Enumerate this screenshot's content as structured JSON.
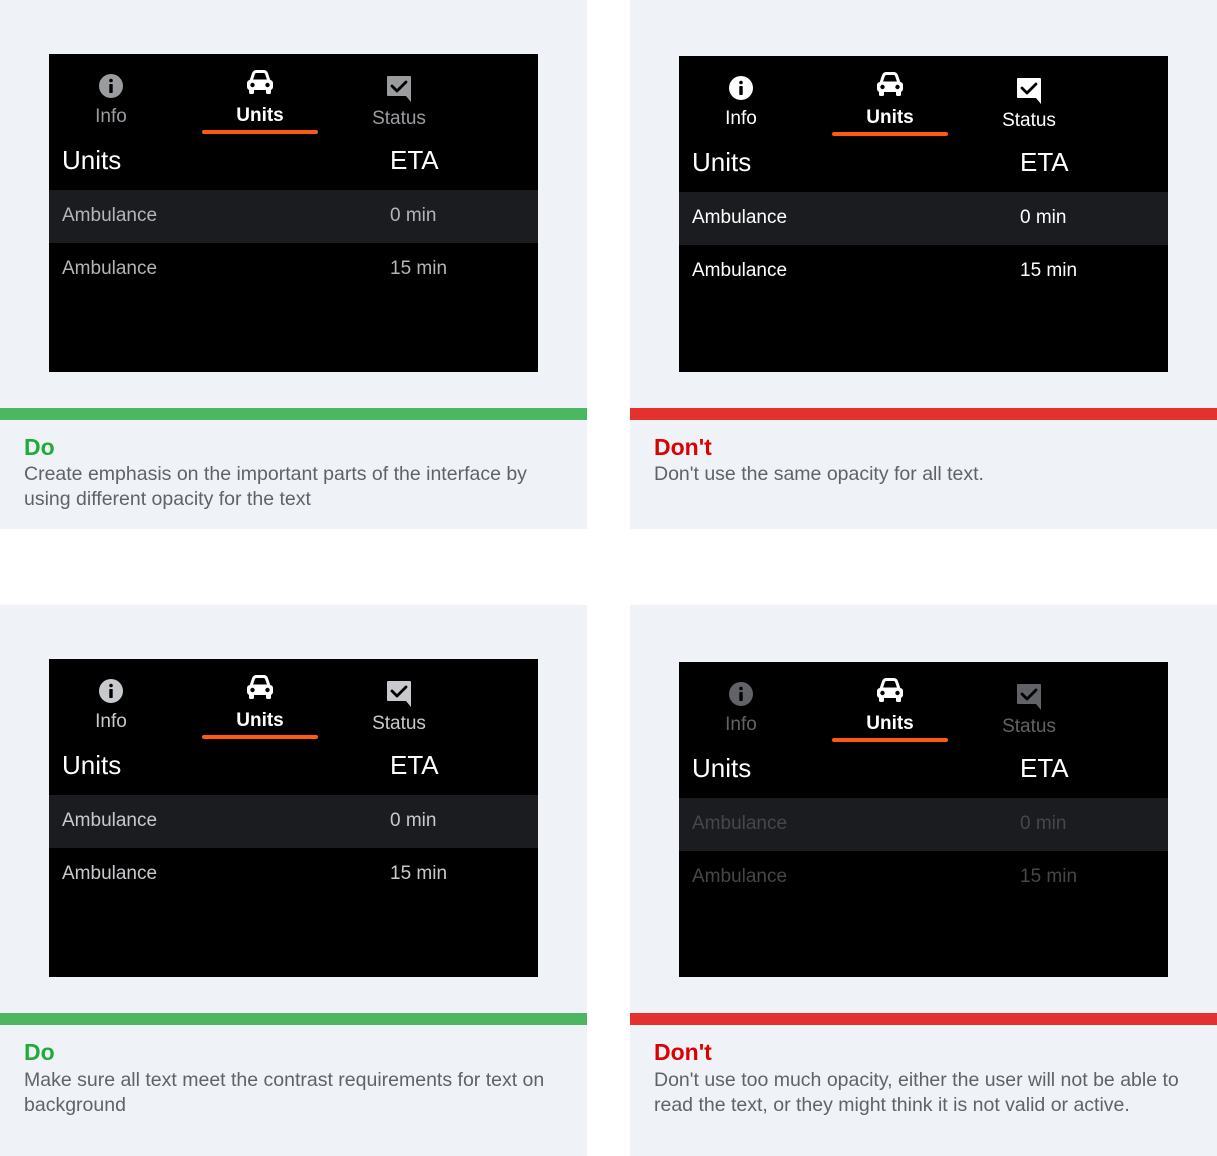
{
  "colors": {
    "page_bg": "#ffffff",
    "card_bg": "#eff2f7",
    "screen_bg": "#000000",
    "row_alt_bg": "#1b1c20",
    "do_green": "#4cb662",
    "do_text": "#22aa3c",
    "dont_red": "#e53030",
    "dont_text": "#dd0000",
    "tab_underline": "#ff5a14",
    "desc_text": "#5f6368"
  },
  "cards": [
    {
      "kind": "do",
      "verdict": "Do",
      "description": "Create emphasis on the important parts of the interface by using different opacity for the text",
      "screen": {
        "tabs": [
          {
            "label": "Info",
            "icon": "info-icon",
            "active": false,
            "color": "#9b9ca0"
          },
          {
            "label": "Units",
            "icon": "car-icon",
            "active": true,
            "color": "#ffffff"
          },
          {
            "label": "Status",
            "icon": "status-check-icon",
            "active": false,
            "color": "#9b9ca0"
          }
        ],
        "header": {
          "col1": "Units",
          "col2": "ETA"
        },
        "rows": [
          {
            "name": "Ambulance",
            "eta": "0 min"
          },
          {
            "name": "Ambulance",
            "eta": "15 min"
          }
        ],
        "row_text_color": "#b4b5b8"
      }
    },
    {
      "kind": "dont",
      "verdict": "Don't",
      "description": "Don't use the same opacity for all text.",
      "screen": {
        "tabs": [
          {
            "label": "Info",
            "icon": "info-icon",
            "active": false,
            "color": "#ffffff"
          },
          {
            "label": "Units",
            "icon": "car-icon",
            "active": true,
            "color": "#ffffff"
          },
          {
            "label": "Status",
            "icon": "status-check-icon",
            "active": false,
            "color": "#ffffff"
          }
        ],
        "header": {
          "col1": "Units",
          "col2": "ETA"
        },
        "rows": [
          {
            "name": "Ambulance",
            "eta": "0 min"
          },
          {
            "name": "Ambulance",
            "eta": "15 min"
          }
        ],
        "row_text_color": "#ffffff"
      }
    },
    {
      "kind": "do",
      "verdict": "Do",
      "description": "Make sure all text meet the contrast requirements for text on background",
      "screen": {
        "tabs": [
          {
            "label": "Info",
            "icon": "info-icon",
            "active": false,
            "color": "#c8c9cc"
          },
          {
            "label": "Units",
            "icon": "car-icon",
            "active": true,
            "color": "#ffffff"
          },
          {
            "label": "Status",
            "icon": "status-check-icon",
            "active": false,
            "color": "#c8c9cc"
          }
        ],
        "header": {
          "col1": "Units",
          "col2": "ETA"
        },
        "rows": [
          {
            "name": "Ambulance",
            "eta": "0 min"
          },
          {
            "name": "Ambulance",
            "eta": "15 min"
          }
        ],
        "row_text_color": "#c8c9cc"
      }
    },
    {
      "kind": "dont",
      "verdict": "Don't",
      "description": "Don't use too much opacity, either the user will not be able to read the text, or they might think it is not valid or active.",
      "screen": {
        "tabs": [
          {
            "label": "Info",
            "icon": "info-icon",
            "active": false,
            "color": "#626366"
          },
          {
            "label": "Units",
            "icon": "car-icon",
            "active": true,
            "color": "#ffffff"
          },
          {
            "label": "Status",
            "icon": "status-check-icon",
            "active": false,
            "color": "#626366"
          }
        ],
        "header": {
          "col1": "Units",
          "col2": "ETA"
        },
        "rows": [
          {
            "name": "Ambulance",
            "eta": "0 min"
          },
          {
            "name": "Ambulance",
            "eta": "15 min"
          }
        ],
        "row_text_color": "#46474a"
      }
    }
  ]
}
